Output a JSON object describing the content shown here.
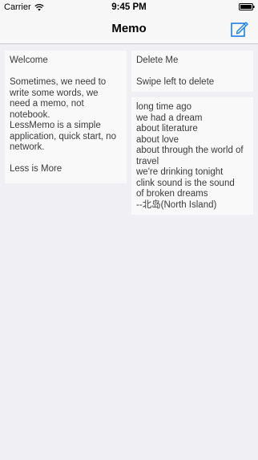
{
  "status_bar": {
    "carrier": "Carrier",
    "time": "9:45 PM",
    "wifi_icon": "wifi-icon",
    "battery_icon": "battery-icon"
  },
  "nav": {
    "title": "Memo",
    "compose_icon": "compose-icon",
    "accent_color": "#1a7fe8"
  },
  "memos": [
    {
      "lines": [
        "Welcome",
        "",
        "Sometimes, we need to",
        "write some words, we",
        "need a memo, not",
        "notebook.",
        "LessMemo is a simple",
        "application, quick start, no",
        "network.",
        "",
        "Less is More"
      ]
    },
    {
      "lines": [
        "Delete Me",
        "",
        "Swipe left to delete"
      ]
    },
    {
      "lines": [
        "long time ago",
        "we had a dream",
        "about literature",
        "about love",
        "about through the world of",
        "travel",
        "we're drinking tonight",
        "clink sound is the sound",
        "of broken dreams",
        "--北岛(North Island)"
      ]
    }
  ],
  "colors": {
    "background": "#efeff4",
    "card": "#f9f9f9",
    "bar": "#f7f7f7"
  }
}
